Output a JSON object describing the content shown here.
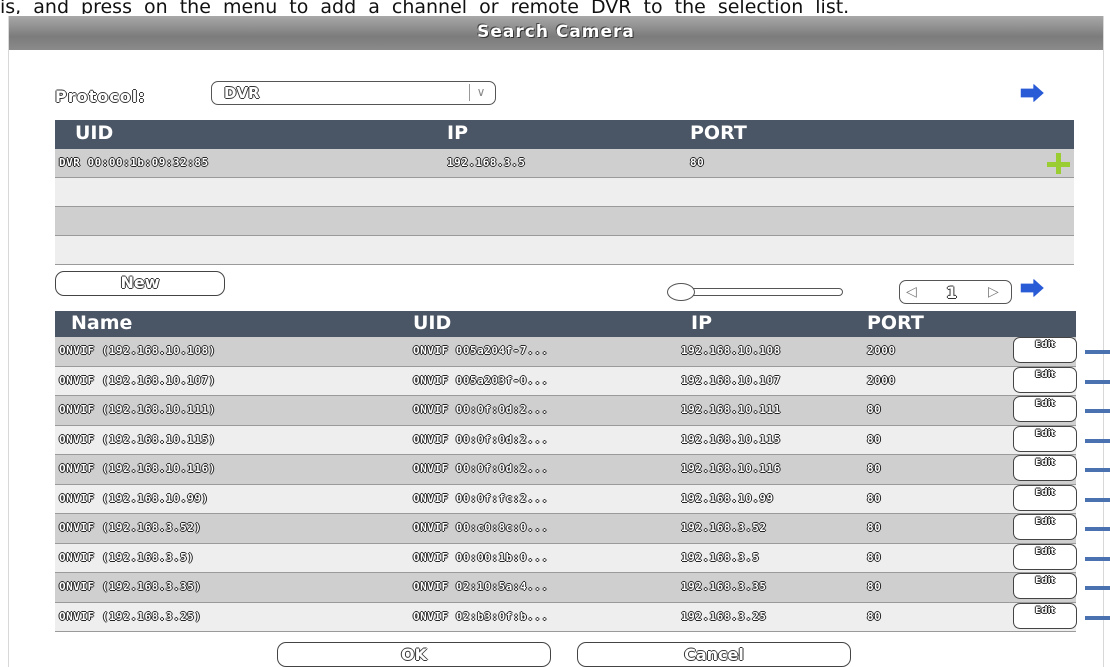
{
  "page_text": "is, and press      on the menu to add a channel or remote DVR to the selection list.",
  "dialog": {
    "title": "Search Camera"
  },
  "protocol": {
    "label": "Protocol:",
    "value": "DVR"
  },
  "search_table": {
    "headers": [
      "UID",
      "IP",
      "PORT"
    ],
    "rows": [
      {
        "uid": "DVR 00:00:1b:09:32:85",
        "ip": "192.168.3.5",
        "port": "80"
      }
    ]
  },
  "new_button": "New",
  "pager": {
    "page": "1"
  },
  "camera_table": {
    "headers": [
      "Name",
      "UID",
      "IP",
      "PORT"
    ],
    "edit_label": "Edit",
    "rows": [
      {
        "name": "ONVIF (192.168.10.108)",
        "uid": "ONVIF 005a204f-7...",
        "ip": "192.168.10.108",
        "port": "2000"
      },
      {
        "name": "ONVIF (192.168.10.107)",
        "uid": "ONVIF 005a203f-0...",
        "ip": "192.168.10.107",
        "port": "2000"
      },
      {
        "name": "ONVIF (192.168.10.111)",
        "uid": "ONVIF 00:0f:0d:2...",
        "ip": "192.168.10.111",
        "port": "80"
      },
      {
        "name": "ONVIF (192.168.10.115)",
        "uid": "ONVIF 00:0f:0d:2...",
        "ip": "192.168.10.115",
        "port": "80"
      },
      {
        "name": "ONVIF (192.168.10.116)",
        "uid": "ONVIF 00:0f:0d:2...",
        "ip": "192.168.10.116",
        "port": "80"
      },
      {
        "name": "ONVIF (192.168.10.99)",
        "uid": "ONVIF 00:0f:fc:2...",
        "ip": "192.168.10.99",
        "port": "80"
      },
      {
        "name": "ONVIF (192.168.3.52)",
        "uid": "ONVIF 00:c0:8c:0...",
        "ip": "192.168.3.52",
        "port": "80"
      },
      {
        "name": "ONVIF (192.168.3.5)",
        "uid": "ONVIF 00:00:1b:0...",
        "ip": "192.168.3.5",
        "port": "80"
      },
      {
        "name": "ONVIF (192.168.3.35)",
        "uid": "ONVIF 02:10:5a:4...",
        "ip": "192.168.3.35",
        "port": "80"
      },
      {
        "name": "ONVIF (192.168.3.25)",
        "uid": "ONVIF 02:b3:0f:b...",
        "ip": "192.168.3.25",
        "port": "80"
      }
    ]
  },
  "footer": {
    "ok": "OK",
    "cancel": "Cancel"
  },
  "colors": {
    "header_bg": "#4a5565",
    "add_icon": "#9acd32",
    "remove_icon": "#4a72b0",
    "back_icon": "#2a5bd6"
  }
}
